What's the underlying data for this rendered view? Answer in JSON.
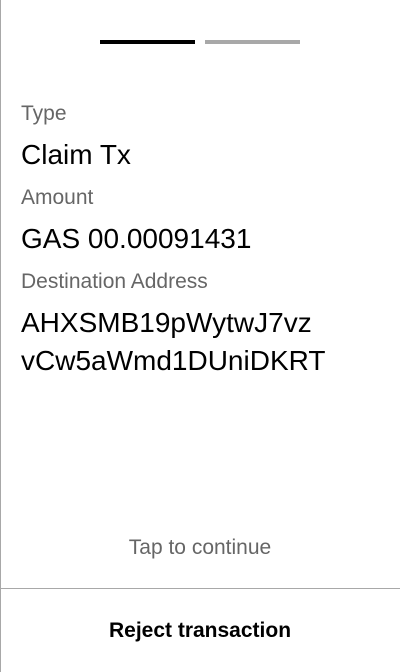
{
  "progress": {
    "current_step": 1,
    "total_steps": 2
  },
  "fields": [
    {
      "label": "Type",
      "value": "Claim Tx"
    },
    {
      "label": "Amount",
      "value": "GAS 00.00091431"
    },
    {
      "label": "Destination Address",
      "value_lines": [
        "AHXSMB19pWytwJ7vz",
        "vCw5aWmd1DUniDKRT"
      ]
    }
  ],
  "tap_hint": "Tap to continue",
  "reject_label": "Reject transaction"
}
